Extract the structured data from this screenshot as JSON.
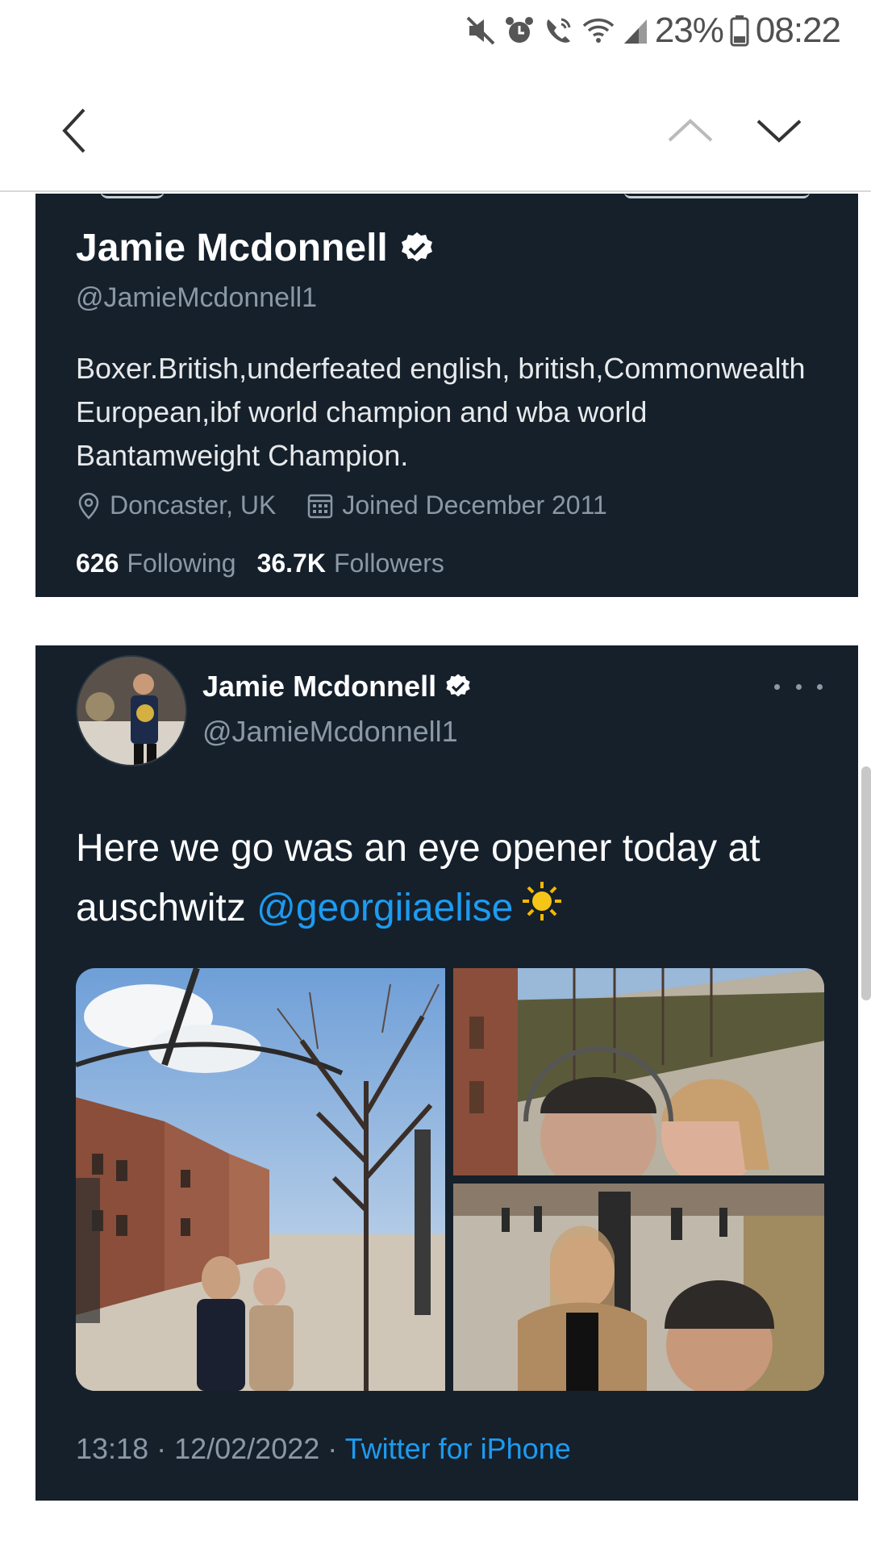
{
  "status_bar": {
    "battery": "23%",
    "time": "08:22",
    "icons": [
      "mute-icon",
      "alarm-icon",
      "wifi-calling-icon",
      "wifi-icon",
      "signal-icon",
      "battery-icon"
    ]
  },
  "nav": {
    "icons": [
      "back-chevron-icon",
      "chevron-up-icon",
      "chevron-down-icon"
    ]
  },
  "profile": {
    "name": "Jamie Mcdonnell",
    "handle": "@JamieMcdonnell1",
    "bio": "Boxer.British,underfeated english, british,Commonwealth European,ibf world champion and wba world Bantamweight Champion.",
    "location": "Doncaster, UK",
    "joined": "Joined December 2011",
    "following_count": "626",
    "following_label": "Following",
    "followers_count": "36.7K",
    "followers_label": "Followers"
  },
  "tweet": {
    "author_name": "Jamie Mcdonnell",
    "author_handle": "@JamieMcdonnell1",
    "text_part1": "Here we go was an eye opener today at auschwitz ",
    "mention": "@georgiiaelise",
    "emoji_icon": "sun-icon",
    "timestamp": "13:18 · 12/02/2022 · ",
    "source": "Twitter for iPhone"
  },
  "colors": {
    "card_bg": "#15202b",
    "accent": "#1d9bf0",
    "muted_text": "#8b98a5"
  }
}
